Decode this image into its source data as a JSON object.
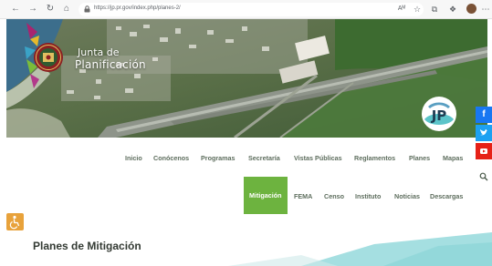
{
  "browser": {
    "url": "https://jp.pr.gov/index.php/planes-2/",
    "icons": [
      "back-icon",
      "forward-icon",
      "refresh-icon",
      "home-icon",
      "lock-icon",
      "read-aloud-icon",
      "favorite-icon",
      "collections-icon",
      "extensions-icon",
      "profile-avatar",
      "more-icon"
    ]
  },
  "header": {
    "logo_line1": "Junta de",
    "logo_line2": "Planificación",
    "badge_text": "JP"
  },
  "nav": {
    "row1": [
      "Inicio",
      "Conócenos",
      "Programas",
      "Secretaría",
      "Vistas Públicas",
      "Reglamentos",
      "Planes",
      "Mapas"
    ],
    "row2": [
      "Mitigación",
      "FEMA",
      "Censo",
      "Instituto",
      "Noticias",
      "Descargas"
    ],
    "active": "Mitigación"
  },
  "social": [
    "facebook-icon",
    "twitter-icon",
    "youtube-icon"
  ],
  "page": {
    "title": "Planes de Mitigación"
  },
  "colors": {
    "accent_green": "#6db33f",
    "menu_text": "#5e6e5e",
    "facebook": "#1877f2",
    "twitter": "#1da1f2",
    "youtube": "#e62117",
    "accessibility": "#e8a23b",
    "decor_teal": "#5bc4c9"
  }
}
